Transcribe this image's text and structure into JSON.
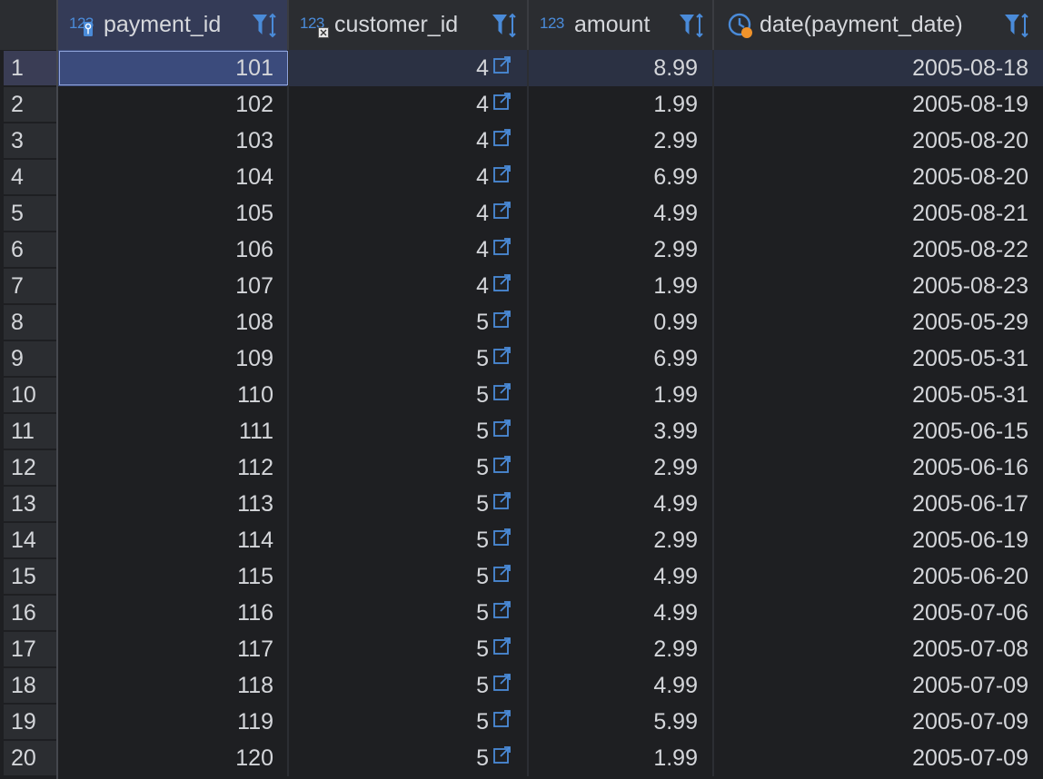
{
  "columns": [
    {
      "name": "payment_id",
      "type_label": "123",
      "badge": "key-icon"
    },
    {
      "name": "customer_id",
      "type_label": "123",
      "badge": "foreign-key-icon"
    },
    {
      "name": "amount",
      "type_label": "123",
      "badge": ""
    },
    {
      "name": "date(payment_date)",
      "type_label": "",
      "badge": "clock-icon"
    }
  ],
  "rows": [
    {
      "num": "1",
      "payment_id": "101",
      "customer_id": "4",
      "amount": "8.99",
      "date": "2005-08-18"
    },
    {
      "num": "2",
      "payment_id": "102",
      "customer_id": "4",
      "amount": "1.99",
      "date": "2005-08-19"
    },
    {
      "num": "3",
      "payment_id": "103",
      "customer_id": "4",
      "amount": "2.99",
      "date": "2005-08-20"
    },
    {
      "num": "4",
      "payment_id": "104",
      "customer_id": "4",
      "amount": "6.99",
      "date": "2005-08-20"
    },
    {
      "num": "5",
      "payment_id": "105",
      "customer_id": "4",
      "amount": "4.99",
      "date": "2005-08-21"
    },
    {
      "num": "6",
      "payment_id": "106",
      "customer_id": "4",
      "amount": "2.99",
      "date": "2005-08-22"
    },
    {
      "num": "7",
      "payment_id": "107",
      "customer_id": "4",
      "amount": "1.99",
      "date": "2005-08-23"
    },
    {
      "num": "8",
      "payment_id": "108",
      "customer_id": "5",
      "amount": "0.99",
      "date": "2005-05-29"
    },
    {
      "num": "9",
      "payment_id": "109",
      "customer_id": "5",
      "amount": "6.99",
      "date": "2005-05-31"
    },
    {
      "num": "10",
      "payment_id": "110",
      "customer_id": "5",
      "amount": "1.99",
      "date": "2005-05-31"
    },
    {
      "num": "11",
      "payment_id": "111",
      "customer_id": "5",
      "amount": "3.99",
      "date": "2005-06-15"
    },
    {
      "num": "12",
      "payment_id": "112",
      "customer_id": "5",
      "amount": "2.99",
      "date": "2005-06-16"
    },
    {
      "num": "13",
      "payment_id": "113",
      "customer_id": "5",
      "amount": "4.99",
      "date": "2005-06-17"
    },
    {
      "num": "14",
      "payment_id": "114",
      "customer_id": "5",
      "amount": "2.99",
      "date": "2005-06-19"
    },
    {
      "num": "15",
      "payment_id": "115",
      "customer_id": "5",
      "amount": "4.99",
      "date": "2005-06-20"
    },
    {
      "num": "16",
      "payment_id": "116",
      "customer_id": "5",
      "amount": "4.99",
      "date": "2005-07-06"
    },
    {
      "num": "17",
      "payment_id": "117",
      "customer_id": "5",
      "amount": "2.99",
      "date": "2005-07-08"
    },
    {
      "num": "18",
      "payment_id": "118",
      "customer_id": "5",
      "amount": "4.99",
      "date": "2005-07-09"
    },
    {
      "num": "19",
      "payment_id": "119",
      "customer_id": "5",
      "amount": "5.99",
      "date": "2005-07-09"
    },
    {
      "num": "20",
      "payment_id": "120",
      "customer_id": "5",
      "amount": "1.99",
      "date": "2005-07-09"
    }
  ],
  "selected_row": "1",
  "colors": {
    "background": "#1e1f22",
    "header": "#2b2d31",
    "accent_blue": "#4a8bd9",
    "selection": "#3b4b7c"
  },
  "icons": {
    "filter": "filter-icon",
    "sort": "sort-arrows-icon",
    "link": "open-reference-icon"
  }
}
